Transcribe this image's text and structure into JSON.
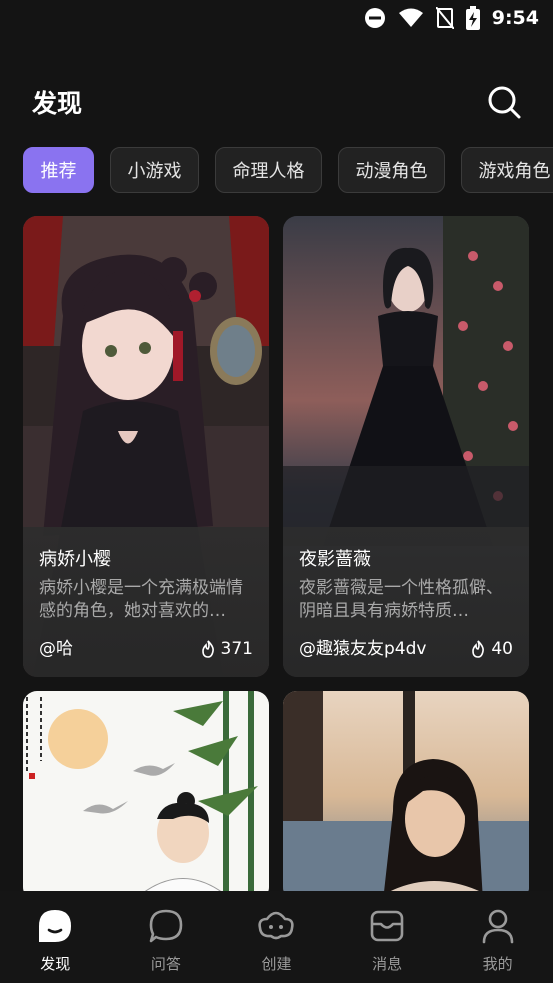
{
  "status_bar": {
    "time": "9:54"
  },
  "header": {
    "title": "发现"
  },
  "tabs": [
    {
      "label": "推荐",
      "active": true
    },
    {
      "label": "小游戏"
    },
    {
      "label": "命理人格"
    },
    {
      "label": "动漫角色"
    },
    {
      "label": "游戏角色"
    }
  ],
  "cards": [
    {
      "name": "病娇小樱",
      "desc": "病娇小樱是一个充满极端情感的角色，她对喜欢的…",
      "author": "@哈",
      "heat": "371"
    },
    {
      "name": "夜影蔷薇",
      "desc": "夜影蔷薇是一个性格孤僻、阴暗且具有病娇特质…",
      "author": "@趣猿友友p4dv",
      "heat": "40"
    },
    {
      "name": "",
      "desc": "",
      "author": "",
      "heat": ""
    },
    {
      "name": "",
      "desc": "",
      "author": "",
      "heat": ""
    }
  ],
  "nav": [
    {
      "label": "发现",
      "icon": "discover-icon",
      "active": true
    },
    {
      "label": "问答",
      "icon": "chat-bubble-icon"
    },
    {
      "label": "创建",
      "icon": "create-icon"
    },
    {
      "label": "消息",
      "icon": "inbox-icon"
    },
    {
      "label": "我的",
      "icon": "profile-icon"
    }
  ],
  "colors": {
    "accent": "#8a73f0",
    "background": "#141414"
  }
}
